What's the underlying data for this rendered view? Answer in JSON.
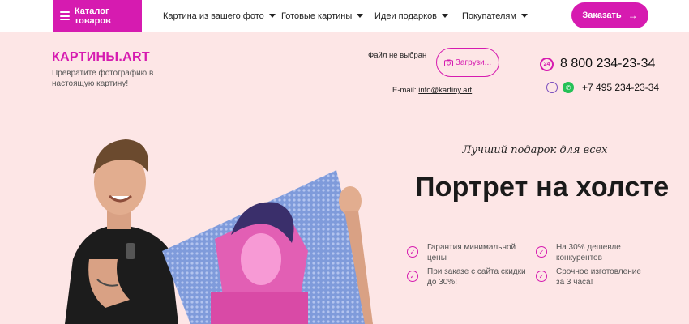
{
  "nav": {
    "catalog_label": "Каталог товаров",
    "items": [
      {
        "label": "Картина из вашего фото"
      },
      {
        "label": "Готовые картины"
      },
      {
        "label": "Идеи подарков"
      },
      {
        "label": "Покупателям"
      }
    ],
    "order_label": "Заказать"
  },
  "header": {
    "logo": "КАРТИНЫ.ART",
    "tagline": "Превратите фотографию в настоящую картину!",
    "file_status": "Файл не выбран",
    "upload_label": "Загрузи...",
    "email_label": "E-mail:",
    "email_value": "info@kartiny.art",
    "phone_main": "8 800 234-23-34",
    "phone_second": "+7 495 234-23-34",
    "phone_badge": "24"
  },
  "hero": {
    "subtitle": "Лучший подарок для всех",
    "title": "Портрет на холсте",
    "features": [
      {
        "text": "Гарантия минимальной цены"
      },
      {
        "text": "На 30% дешевле конкурентов"
      },
      {
        "text": "При заказе с сайта скидки до 30%!"
      },
      {
        "text": "Срочное изготовление за 3 часа!"
      }
    ]
  },
  "colors": {
    "accent": "#d61bb0",
    "background": "#fde6e6",
    "whatsapp": "#25c157"
  }
}
